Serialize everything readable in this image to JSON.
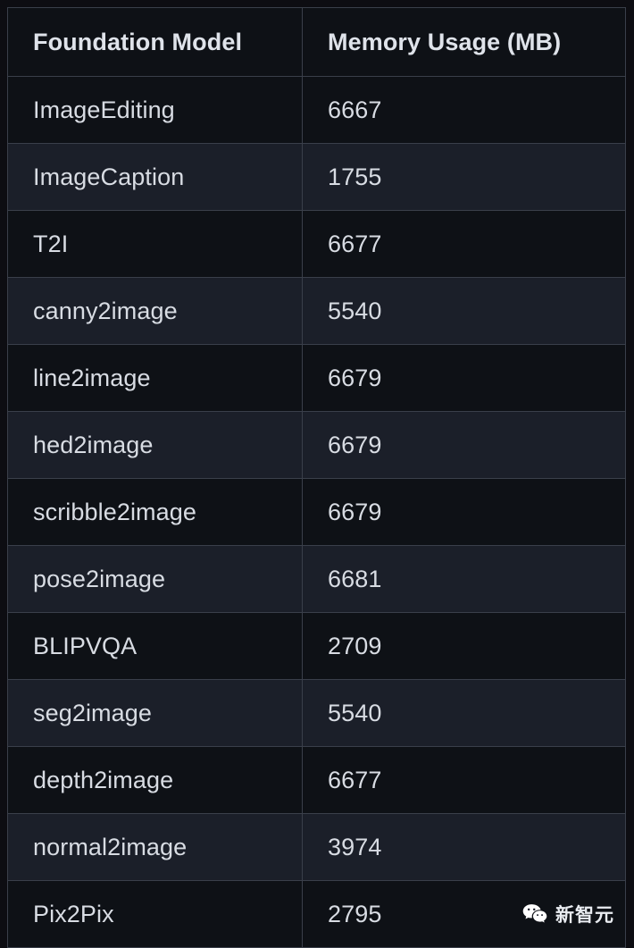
{
  "table": {
    "columns": [
      "Foundation Model",
      "Memory Usage (MB)"
    ],
    "rows": [
      {
        "model": "ImageEditing",
        "memory": "6667"
      },
      {
        "model": "ImageCaption",
        "memory": "1755"
      },
      {
        "model": "T2I",
        "memory": "6677"
      },
      {
        "model": "canny2image",
        "memory": "5540"
      },
      {
        "model": "line2image",
        "memory": "6679"
      },
      {
        "model": "hed2image",
        "memory": "6679"
      },
      {
        "model": "scribble2image",
        "memory": "6679"
      },
      {
        "model": "pose2image",
        "memory": "6681"
      },
      {
        "model": "BLIPVQA",
        "memory": "2709"
      },
      {
        "model": "seg2image",
        "memory": "5540"
      },
      {
        "model": "depth2image",
        "memory": "6677"
      },
      {
        "model": "normal2image",
        "memory": "3974"
      },
      {
        "model": "Pix2Pix",
        "memory": "2795"
      }
    ]
  },
  "watermark": {
    "icon": "wechat-icon",
    "text": "新智元"
  },
  "colors": {
    "page_background": "#0d0d12",
    "row_odd_background": "#0e1116",
    "row_even_background": "#1b1f29",
    "border": "#3a3f4a",
    "text": "#d8dce3",
    "header_text": "#dfe3ea"
  }
}
